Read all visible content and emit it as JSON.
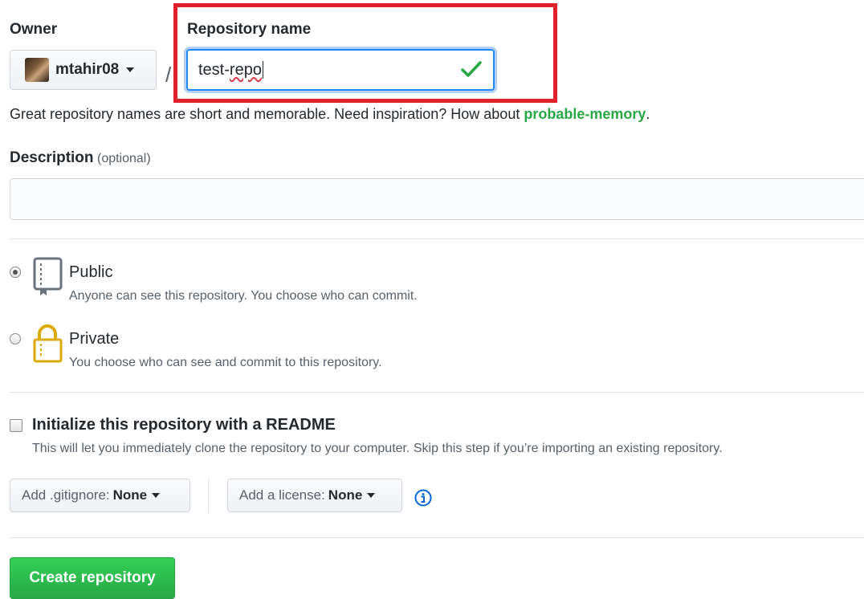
{
  "owner": {
    "label": "Owner",
    "name": "mtahir08"
  },
  "separator": "/",
  "repo_name": {
    "label": "Repository name",
    "value_plain": "test-",
    "value_squiggle": "repo"
  },
  "hint": {
    "text": "Great repository names are short and memorable. Need inspiration? How about ",
    "suggestion": "probable-memory",
    "end": "."
  },
  "description": {
    "label": "Description",
    "optional": "(optional)",
    "value": ""
  },
  "visibility": {
    "selected": "public",
    "options": [
      {
        "title": "Public",
        "desc": "Anyone can see this repository. You choose who can commit.",
        "icon": "repo-book-icon"
      },
      {
        "title": "Private",
        "desc": "You choose who can see and commit to this repository.",
        "icon": "lock-icon"
      }
    ]
  },
  "readme": {
    "checked": false,
    "title": "Initialize this repository with a README",
    "desc": "This will let you immediately clone the repository to your computer. Skip this step if you’re importing an existing repository."
  },
  "gitignore": {
    "prefix": "Add .gitignore:",
    "value": "None"
  },
  "license": {
    "prefix": "Add a license:",
    "value": "None"
  },
  "info_icon": "info-icon",
  "create_button": "Create repository",
  "colors": {
    "accent_blue": "#2188ff",
    "success_green": "#28a745",
    "highlight_red": "#e0202b",
    "info_blue": "#0366d6"
  }
}
